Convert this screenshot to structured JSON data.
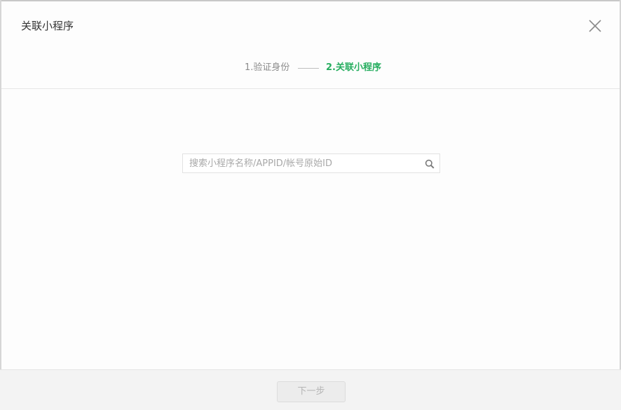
{
  "dialog": {
    "title": "关联小程序"
  },
  "steps": [
    {
      "label": "1.验证身份",
      "active": false
    },
    {
      "label": "2.关联小程序",
      "active": true
    }
  ],
  "search": {
    "placeholder": "搜索小程序名称/APPID/帐号原始ID",
    "value": "",
    "icon": "search-icon"
  },
  "footer": {
    "next_label": "下一步",
    "next_enabled": false
  },
  "colors": {
    "accent": "#27ae60",
    "muted": "#8c8c8c",
    "title": "#353535"
  },
  "icons": {
    "close": "close-icon"
  }
}
